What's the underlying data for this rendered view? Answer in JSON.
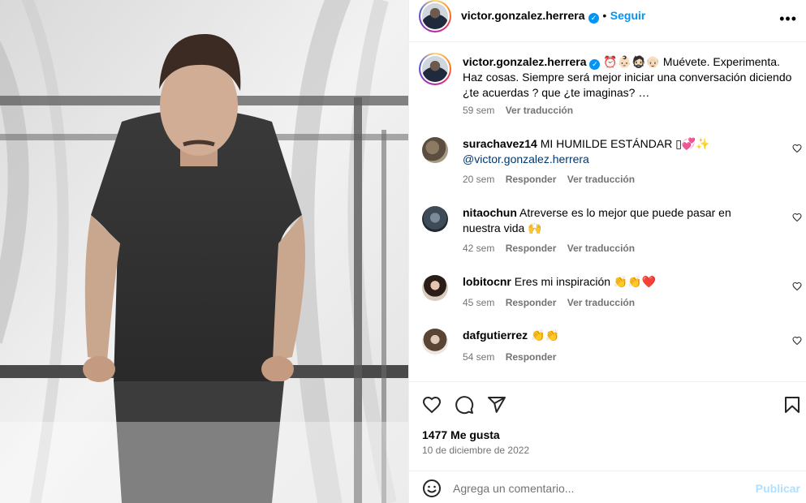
{
  "post": {
    "author": "victor.gonzalez.herrera",
    "follow_label": "Seguir",
    "separator": "•",
    "more_label": "•••",
    "verified_mark": "✓"
  },
  "caption": {
    "username": "victor.gonzalez.herrera",
    "emojis": "⏰👶🏻🧔🏻👴🏻",
    "text_line1": "Muévete.",
    "text_rest": "Experimenta. Haz cosas. Siempre será mejor iniciar una conversación diciendo ¿te acuerdas ? que ¿te imaginas? …",
    "time": "59 sem",
    "translate": "Ver traducción"
  },
  "comments": [
    {
      "username": "surachavez14",
      "text": "MI HUMILDE ESTÁNDAR ▯💞✨",
      "mention": "@victor.gonzalez.herrera",
      "time": "20 sem",
      "reply": "Responder",
      "translate": "Ver traducción"
    },
    {
      "username": "nitaochun",
      "text": "Atreverse es lo mejor que puede pasar en nuestra vida 🙌",
      "time": "42 sem",
      "reply": "Responder",
      "translate": "Ver traducción"
    },
    {
      "username": "lobitocnr",
      "text": "Eres mi inspiración 👏👏❤️",
      "time": "45 sem",
      "reply": "Responder",
      "translate": "Ver traducción"
    },
    {
      "username": "dafgutierrez",
      "text": "👏👏",
      "time": "54 sem",
      "reply": "Responder"
    }
  ],
  "stats": {
    "likes": "1477 Me gusta",
    "date": "10 de diciembre de 2022"
  },
  "add_comment": {
    "placeholder": "Agrega un comentario...",
    "post_label": "Publicar"
  },
  "icons": [
    "heart-icon",
    "comment-icon",
    "share-icon",
    "bookmark-icon",
    "emoji-icon",
    "more-icon",
    "verified-icon"
  ],
  "colors": {
    "link": "#0095f6",
    "muted": "#737373",
    "mention": "#00376b",
    "publish_disabled": "#b2dffc"
  }
}
